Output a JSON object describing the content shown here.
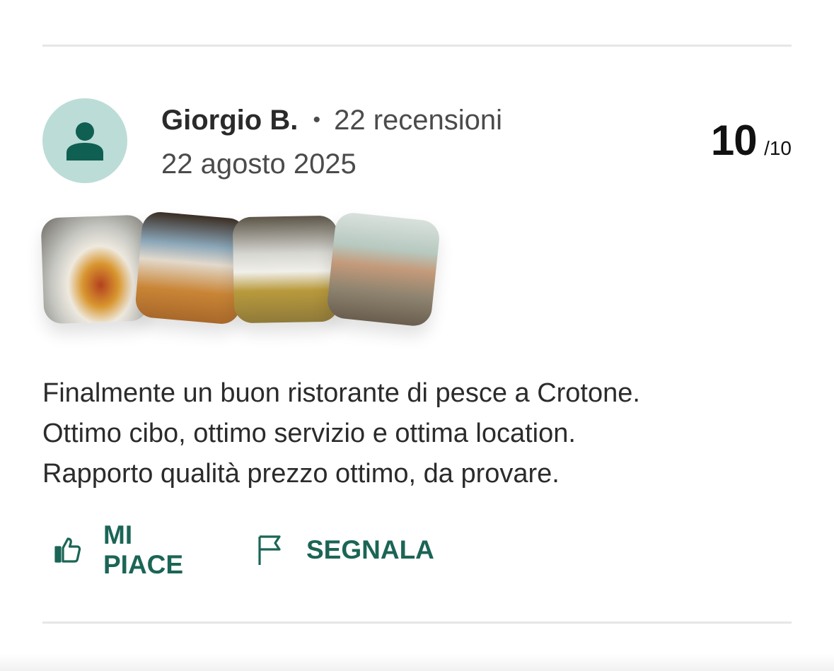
{
  "reviewer": {
    "name": "Giorgio B.",
    "separator": "•",
    "review_count": "22 recensioni",
    "date": "22 agosto 2025",
    "avatar_icon": "user-icon"
  },
  "rating": {
    "score": "10",
    "max": "/10"
  },
  "photos": [
    {
      "name": "review-photo-1"
    },
    {
      "name": "review-photo-2"
    },
    {
      "name": "review-photo-3"
    },
    {
      "name": "review-photo-4"
    }
  ],
  "review": {
    "lines": [
      "Finalmente un buon ristorante di pesce a Crotone.",
      "Ottimo cibo, ottimo servizio e ottima location.",
      "Rapporto qualità prezzo ottimo, da provare."
    ]
  },
  "actions": {
    "like_label": "MI PIACE",
    "like_icon": "thumbs-up-icon",
    "report_label": "SEGNALA",
    "report_icon": "flag-icon"
  },
  "colors": {
    "accent": "#1b6556",
    "avatar_bg": "#bcdcd7"
  }
}
